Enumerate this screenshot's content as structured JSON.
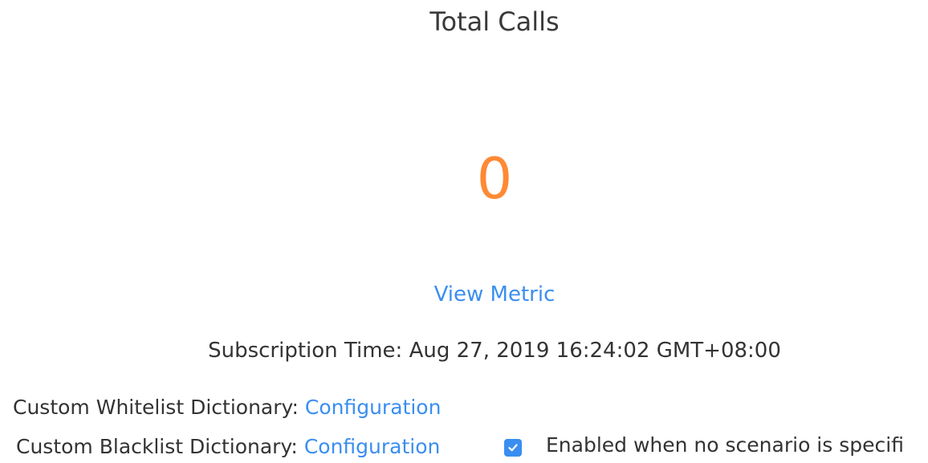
{
  "stats": {
    "title": "Total Calls",
    "value": "0",
    "view_metric_label": "View Metric",
    "subscription_time": "Subscription Time: Aug 27, 2019 16:24:02 GMT+08:00"
  },
  "dictionaries": {
    "whitelist_label": "Custom Whitelist Dictionary:",
    "whitelist_link": "Configuration",
    "blacklist_label": "Custom Blacklist Dictionary:",
    "blacklist_link": "Configuration",
    "enabled_checkbox_label": "Enabled when no scenario is specifi",
    "enabled_checked": true
  },
  "colors": {
    "accent": "#3a8ef0",
    "value": "#ff8a35",
    "text": "#333333"
  },
  "icons": {
    "checkbox": "check-icon"
  }
}
